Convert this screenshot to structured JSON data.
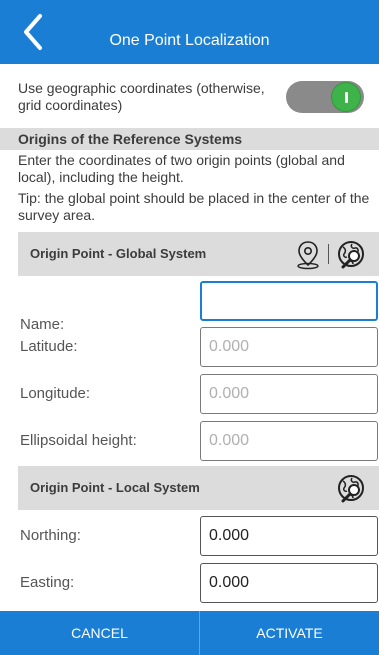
{
  "header": {
    "title": "One Point Localization",
    "back_icon": "chevron-left-icon"
  },
  "toggle": {
    "label": "Use geographic coordinates (otherwise, grid coordinates)",
    "state": "on"
  },
  "section": {
    "title": "Origins of the Reference Systems",
    "description": "Enter the coordinates of two origin points (global and local), including the height.",
    "tip": "Tip: the global point should be placed in the center of the survey area."
  },
  "global": {
    "title": "Origin Point - Global System",
    "icons": [
      "map-pin-icon",
      "globe-search-icon"
    ],
    "fields": [
      {
        "label": "Name:",
        "value": "",
        "placeholder": ""
      },
      {
        "label": "Latitude:",
        "value": "",
        "placeholder": "0.000"
      },
      {
        "label": "Longitude:",
        "value": "",
        "placeholder": "0.000"
      },
      {
        "label": "Ellipsoidal height:",
        "value": "",
        "placeholder": "0.000"
      }
    ]
  },
  "local": {
    "title": "Origin Point - Local System",
    "icons": [
      "globe-search-icon"
    ],
    "fields": [
      {
        "label": "Northing:",
        "value": "0.000"
      },
      {
        "label": "Easting:",
        "value": "0.000"
      }
    ]
  },
  "footer": {
    "cancel": "CANCEL",
    "activate": "ACTIVATE"
  },
  "colors": {
    "primary": "#1a7fd4",
    "toggle_on": "#3eb34a",
    "section_bg": "#dcdcdc"
  }
}
